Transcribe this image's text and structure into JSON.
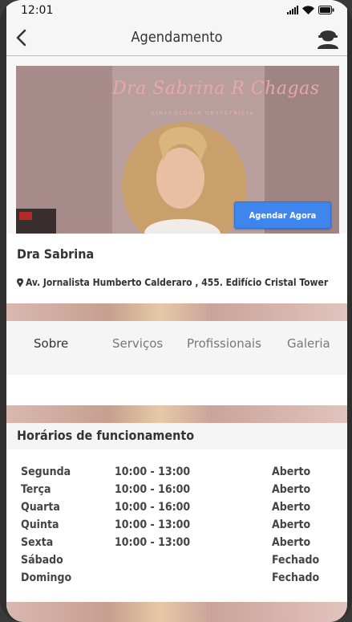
{
  "status_bar": {
    "time": "12:01"
  },
  "header": {
    "title": "Agendamento"
  },
  "hero": {
    "brand_script": "Dra Sabrina R Chagas",
    "brand_sub": "GINECOLOGIA  OBSTETRÍCIA",
    "cta_label": "Agendar Agora"
  },
  "clinic": {
    "name": "Dra Sabrina",
    "address": "Av. Jornalista Humberto Calderaro , 455. Edifício Cristal Tower"
  },
  "tabs": [
    {
      "label": "Sobre",
      "active": true
    },
    {
      "label": "Serviços",
      "active": false
    },
    {
      "label": "Profissionais",
      "active": false
    },
    {
      "label": "Galeria",
      "active": false
    }
  ],
  "hours": {
    "title": "Horários de funcionamento",
    "rows": [
      {
        "day": "Segunda",
        "time": "10:00 - 13:00",
        "status": "Aberto"
      },
      {
        "day": "Terça",
        "time": "10:00 - 16:00",
        "status": "Aberto"
      },
      {
        "day": "Quarta",
        "time": "10:00 - 16:00",
        "status": "Aberto"
      },
      {
        "day": "Quinta",
        "time": "10:00 - 13:00",
        "status": "Aberto"
      },
      {
        "day": "Sexta",
        "time": "10:00 - 13:00",
        "status": "Aberto"
      },
      {
        "day": "Sábado",
        "time": "",
        "status": "Fechado"
      },
      {
        "day": "Domingo",
        "time": "",
        "status": "Fechado"
      }
    ]
  },
  "colors": {
    "accent": "#3e86ee",
    "header_bg": "#f6f6f6",
    "text": "#333333"
  },
  "icons": [
    "back-arrow-icon",
    "profile-icon",
    "location-pin-icon",
    "signal-icon",
    "wifi-icon",
    "battery-icon"
  ]
}
